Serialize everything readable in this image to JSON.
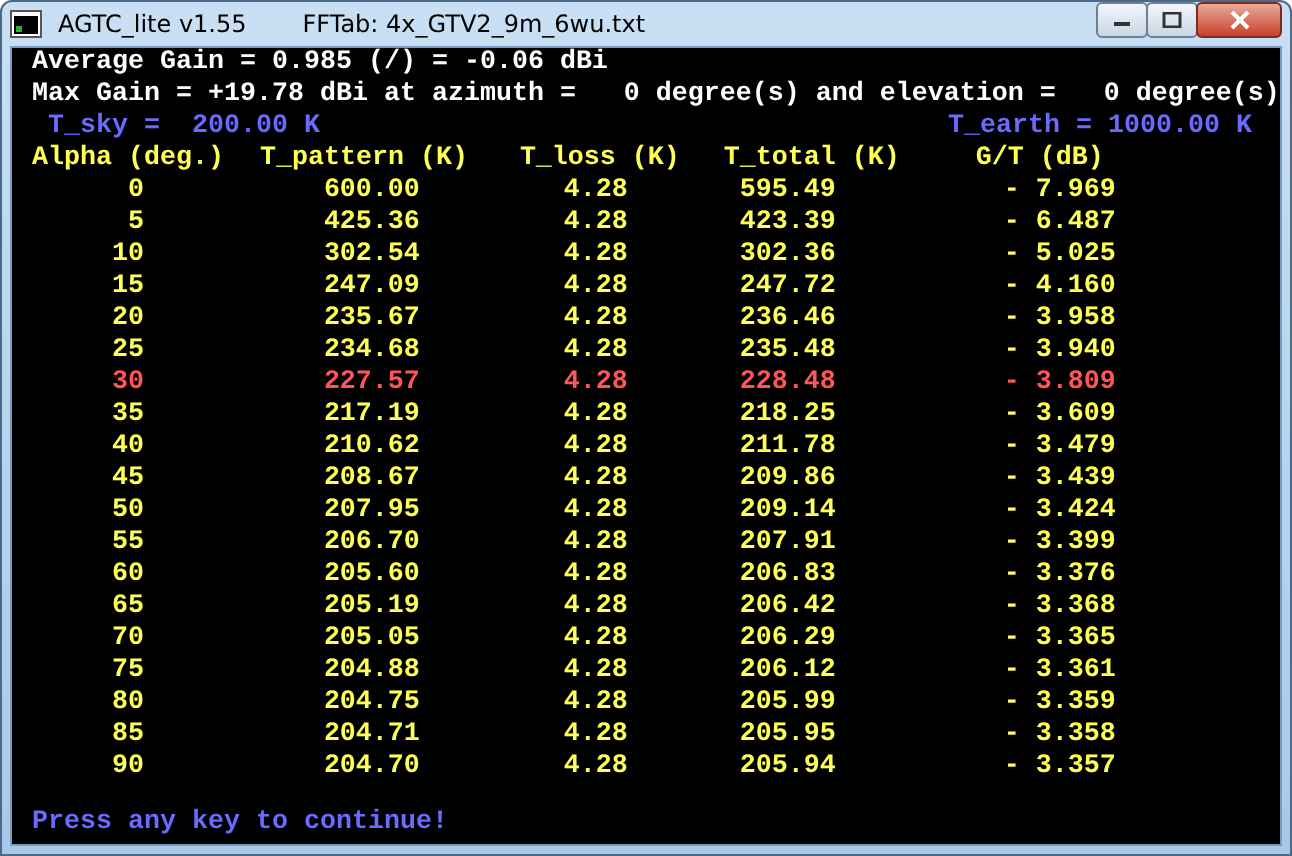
{
  "window": {
    "app_title": "AGTC_lite v1.55",
    "document_title": "FFTab: 4x_GTV2_9m_6wu.txt"
  },
  "summary": [
    "Average Gain = 0.985 (/) = -0.06 dBi",
    "Max Gain = +19.78 dBi at azimuth =   0 degree(s) and elevation =   0 degree(s)"
  ],
  "t_sky": "T_sky =  200.00 K",
  "t_earth": "T_earth = 1000.00 K",
  "table": {
    "columns": [
      "Alpha (deg.)",
      "T_pattern (K)",
      "T_loss (K)",
      "T_total (K)",
      "G/T (dB)"
    ],
    "rows": [
      {
        "cells": [
          "0",
          "600.00",
          "4.28",
          "595.49",
          "- 7.969"
        ],
        "highlighted": false
      },
      {
        "cells": [
          "5",
          "425.36",
          "4.28",
          "423.39",
          "- 6.487"
        ],
        "highlighted": false
      },
      {
        "cells": [
          "10",
          "302.54",
          "4.28",
          "302.36",
          "- 5.025"
        ],
        "highlighted": false
      },
      {
        "cells": [
          "15",
          "247.09",
          "4.28",
          "247.72",
          "- 4.160"
        ],
        "highlighted": false
      },
      {
        "cells": [
          "20",
          "235.67",
          "4.28",
          "236.46",
          "- 3.958"
        ],
        "highlighted": false
      },
      {
        "cells": [
          "25",
          "234.68",
          "4.28",
          "235.48",
          "- 3.940"
        ],
        "highlighted": false
      },
      {
        "cells": [
          "30",
          "227.57",
          "4.28",
          "228.48",
          "- 3.809"
        ],
        "highlighted": true
      },
      {
        "cells": [
          "35",
          "217.19",
          "4.28",
          "218.25",
          "- 3.609"
        ],
        "highlighted": false
      },
      {
        "cells": [
          "40",
          "210.62",
          "4.28",
          "211.78",
          "- 3.479"
        ],
        "highlighted": false
      },
      {
        "cells": [
          "45",
          "208.67",
          "4.28",
          "209.86",
          "- 3.439"
        ],
        "highlighted": false
      },
      {
        "cells": [
          "50",
          "207.95",
          "4.28",
          "209.14",
          "- 3.424"
        ],
        "highlighted": false
      },
      {
        "cells": [
          "55",
          "206.70",
          "4.28",
          "207.91",
          "- 3.399"
        ],
        "highlighted": false
      },
      {
        "cells": [
          "60",
          "205.60",
          "4.28",
          "206.83",
          "- 3.376"
        ],
        "highlighted": false
      },
      {
        "cells": [
          "65",
          "205.19",
          "4.28",
          "206.42",
          "- 3.368"
        ],
        "highlighted": false
      },
      {
        "cells": [
          "70",
          "205.05",
          "4.28",
          "206.29",
          "- 3.365"
        ],
        "highlighted": false
      },
      {
        "cells": [
          "75",
          "204.88",
          "4.28",
          "206.12",
          "- 3.361"
        ],
        "highlighted": false
      },
      {
        "cells": [
          "80",
          "204.75",
          "4.28",
          "205.99",
          "- 3.359"
        ],
        "highlighted": false
      },
      {
        "cells": [
          "85",
          "204.71",
          "4.28",
          "205.95",
          "- 3.358"
        ],
        "highlighted": false
      },
      {
        "cells": [
          "90",
          "204.70",
          "4.28",
          "205.94",
          "- 3.357"
        ],
        "highlighted": false
      }
    ]
  },
  "prompt": "Press any key to continue!"
}
